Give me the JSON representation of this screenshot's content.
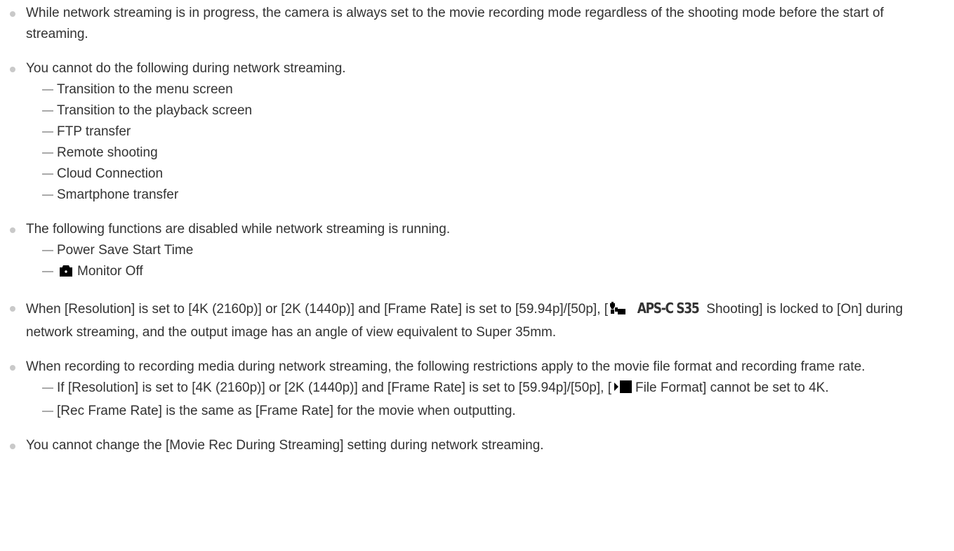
{
  "notes": [
    {
      "text": "While network streaming is in progress, the camera is always set to the movie recording mode regardless of the shooting mode before the start of streaming."
    },
    {
      "text": "You cannot do the following during network streaming.",
      "sub": [
        "Transition to the menu screen",
        "Transition to the playback screen",
        "FTP transfer",
        "Remote shooting",
        "Cloud Connection",
        "Smartphone transfer"
      ]
    },
    {
      "text": "The following functions are disabled while network streaming is running.",
      "sub": [
        "Power Save Start Time",
        "Monitor Off"
      ]
    },
    {
      "text_before": "When [Resolution] is set to [4K (2160p)] or [2K (1440p)] and [Frame Rate] is set to [59.94p]/[50p], [",
      "aps_label": "APS-C S35",
      "text_after": "Shooting] is locked to [On] during network streaming, and the output image has an angle of view equivalent to Super 35mm."
    },
    {
      "text": "When recording to recording media during network streaming, the following restrictions apply to the movie file format and recording frame rate.",
      "sub_a_before": "If [Resolution] is set to [4K (2160p)] or [2K (1440p)] and [Frame Rate] is set to [59.94p]/[50p], [",
      "sub_a_after": "File Format] cannot be set to 4K.",
      "sub_b": "[Rec Frame Rate] is the same as [Frame Rate] for the movie when outputting."
    },
    {
      "text": "You cannot change the [Movie Rec During Streaming] setting during network streaming."
    }
  ],
  "icons": {
    "bullet": "bullet-dot-icon",
    "dash": "dash-icon",
    "camera": "camera-icon",
    "photo_movie": "photo-movie-icon",
    "movie": "movie-icon"
  },
  "colors": {
    "text": "#333333",
    "bullet": "#c9c9c9",
    "dash": "#aaaaaa",
    "icon": "#000000"
  }
}
